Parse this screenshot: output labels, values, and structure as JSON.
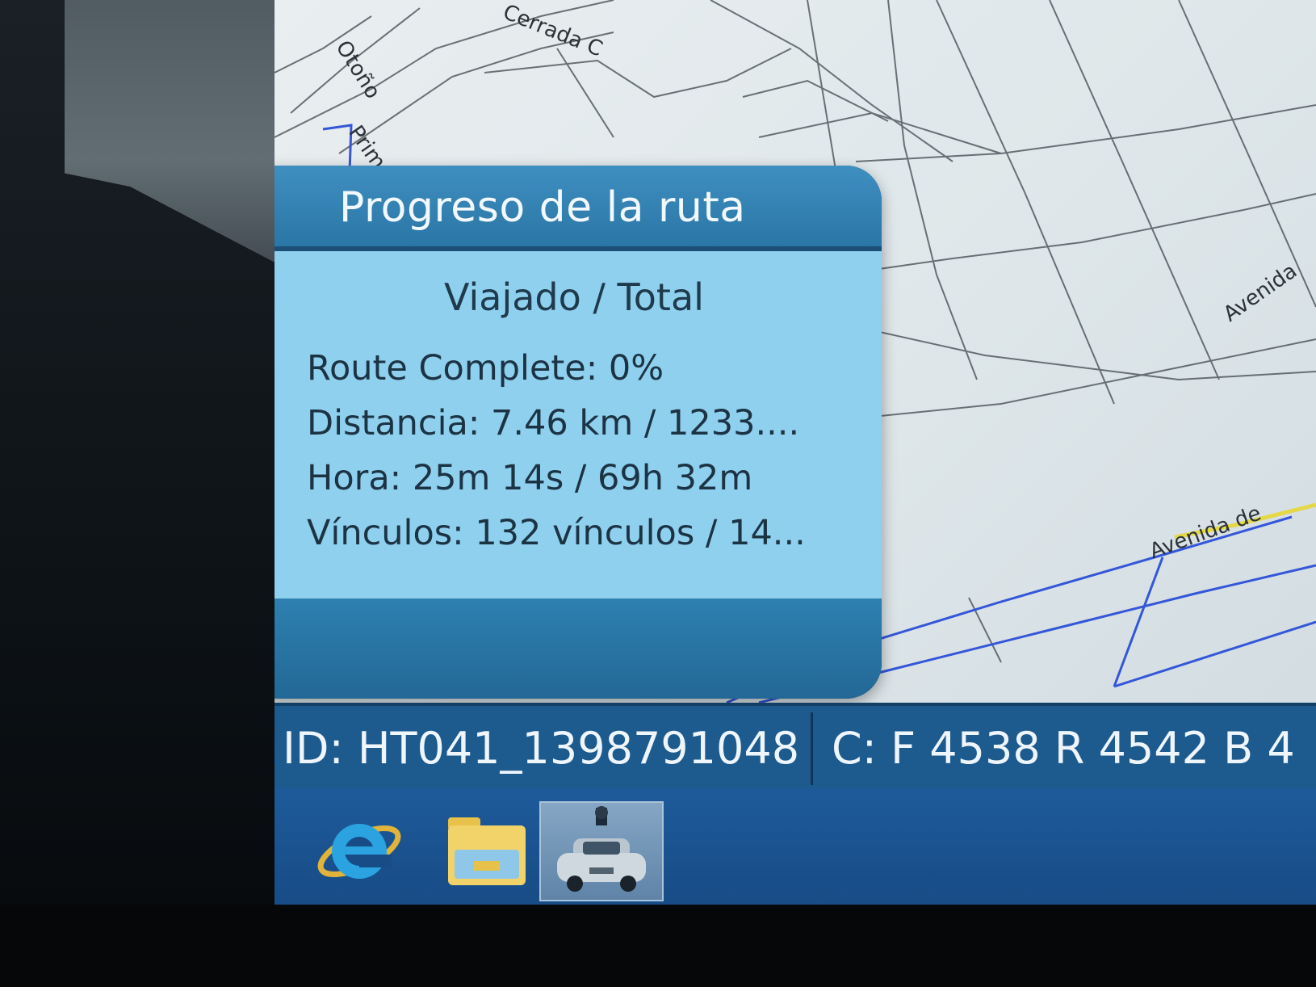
{
  "map": {
    "street_labels": [
      "Cerrada C",
      "Otoño",
      "Primavera",
      "Avenida",
      "Avenida de"
    ]
  },
  "popup": {
    "title": "Progreso de la ruta",
    "subtitle": "Viajado / Total",
    "rows": [
      {
        "text": "Route Complete: 0%"
      },
      {
        "text": "Distancia: 7.46 km / 1233...."
      },
      {
        "text": "Hora: 25m 14s / 69h 32m"
      },
      {
        "text": "Vínculos: 132 vínculos / 14..."
      }
    ]
  },
  "status_bar": {
    "id_text": "ID: HT041_1398791048",
    "counts_text": "C: F 4538 R 4542 B 4"
  },
  "taskbar": {
    "items": [
      {
        "icon": "internet-explorer-icon",
        "active": false
      },
      {
        "icon": "folder-icon",
        "active": false
      },
      {
        "icon": "car-camera-app-icon",
        "active": true
      }
    ]
  },
  "colors": {
    "popup_title_bg": "#2a76a6",
    "popup_body_bg": "#8fd0ef",
    "status_bar_bg": "#1d5a8e",
    "taskbar_bg": "#174c86",
    "route_line": "#3456d8",
    "highlight_road": "#e4d84a"
  }
}
